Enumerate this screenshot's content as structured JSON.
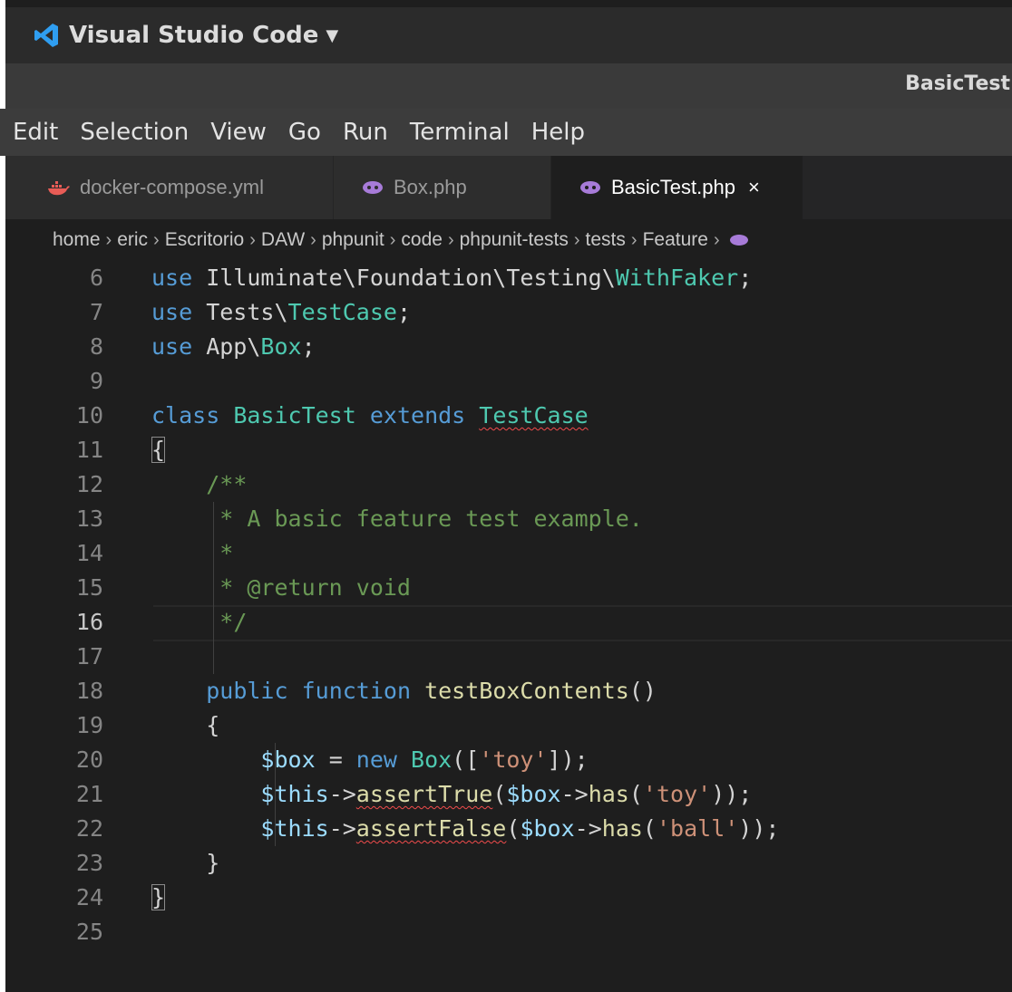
{
  "app": {
    "name": "Visual Studio Code",
    "caret": "▼",
    "logo": "vscode-icon"
  },
  "window": {
    "title": "BasicTest"
  },
  "menu": [
    "Edit",
    "Selection",
    "View",
    "Go",
    "Run",
    "Terminal",
    "Help"
  ],
  "tabs": [
    {
      "label": "docker-compose.yml",
      "icon": "docker-icon",
      "active": false
    },
    {
      "label": "Box.php",
      "icon": "php-icon",
      "active": false
    },
    {
      "label": "BasicTest.php",
      "icon": "php-icon",
      "active": true,
      "close": "×"
    }
  ],
  "breadcrumb": [
    "home",
    "eric",
    "Escritorio",
    "DAW",
    "phpunit",
    "code",
    "phpunit-tests",
    "tests",
    "Feature"
  ],
  "breadcrumb_sep": "›",
  "editor": {
    "current_line": 16,
    "lines": [
      {
        "n": "6",
        "code": "use Illuminate\\Foundation\\Testing\\WithFaker;"
      },
      {
        "n": "7",
        "code": "use Tests\\TestCase;"
      },
      {
        "n": "8",
        "code": "use App\\Box;"
      },
      {
        "n": "9",
        "code": ""
      },
      {
        "n": "10",
        "code": "class BasicTest extends TestCase"
      },
      {
        "n": "11",
        "code": "{"
      },
      {
        "n": "12",
        "code": "    /**"
      },
      {
        "n": "13",
        "code": "     * A basic feature test example."
      },
      {
        "n": "14",
        "code": "     *"
      },
      {
        "n": "15",
        "code": "     * @return void"
      },
      {
        "n": "16",
        "code": "     */"
      },
      {
        "n": "17",
        "code": ""
      },
      {
        "n": "18",
        "code": "    public function testBoxContents()"
      },
      {
        "n": "19",
        "code": "    {"
      },
      {
        "n": "20",
        "code": "        $box = new Box(['toy']);"
      },
      {
        "n": "21",
        "code": "        $this->assertTrue($box->has('toy'));"
      },
      {
        "n": "22",
        "code": "        $this->assertFalse($box->has('ball'));"
      },
      {
        "n": "23",
        "code": "    }"
      },
      {
        "n": "24",
        "code": "}"
      },
      {
        "n": "25",
        "code": ""
      }
    ]
  },
  "colors": {
    "keyword": "#569cd6",
    "type": "#4ec9b0",
    "string": "#ce9178",
    "comment": "#6a9955",
    "function": "#dcdcaa",
    "variable": "#9cdcfe",
    "background": "#1e1e1e"
  }
}
